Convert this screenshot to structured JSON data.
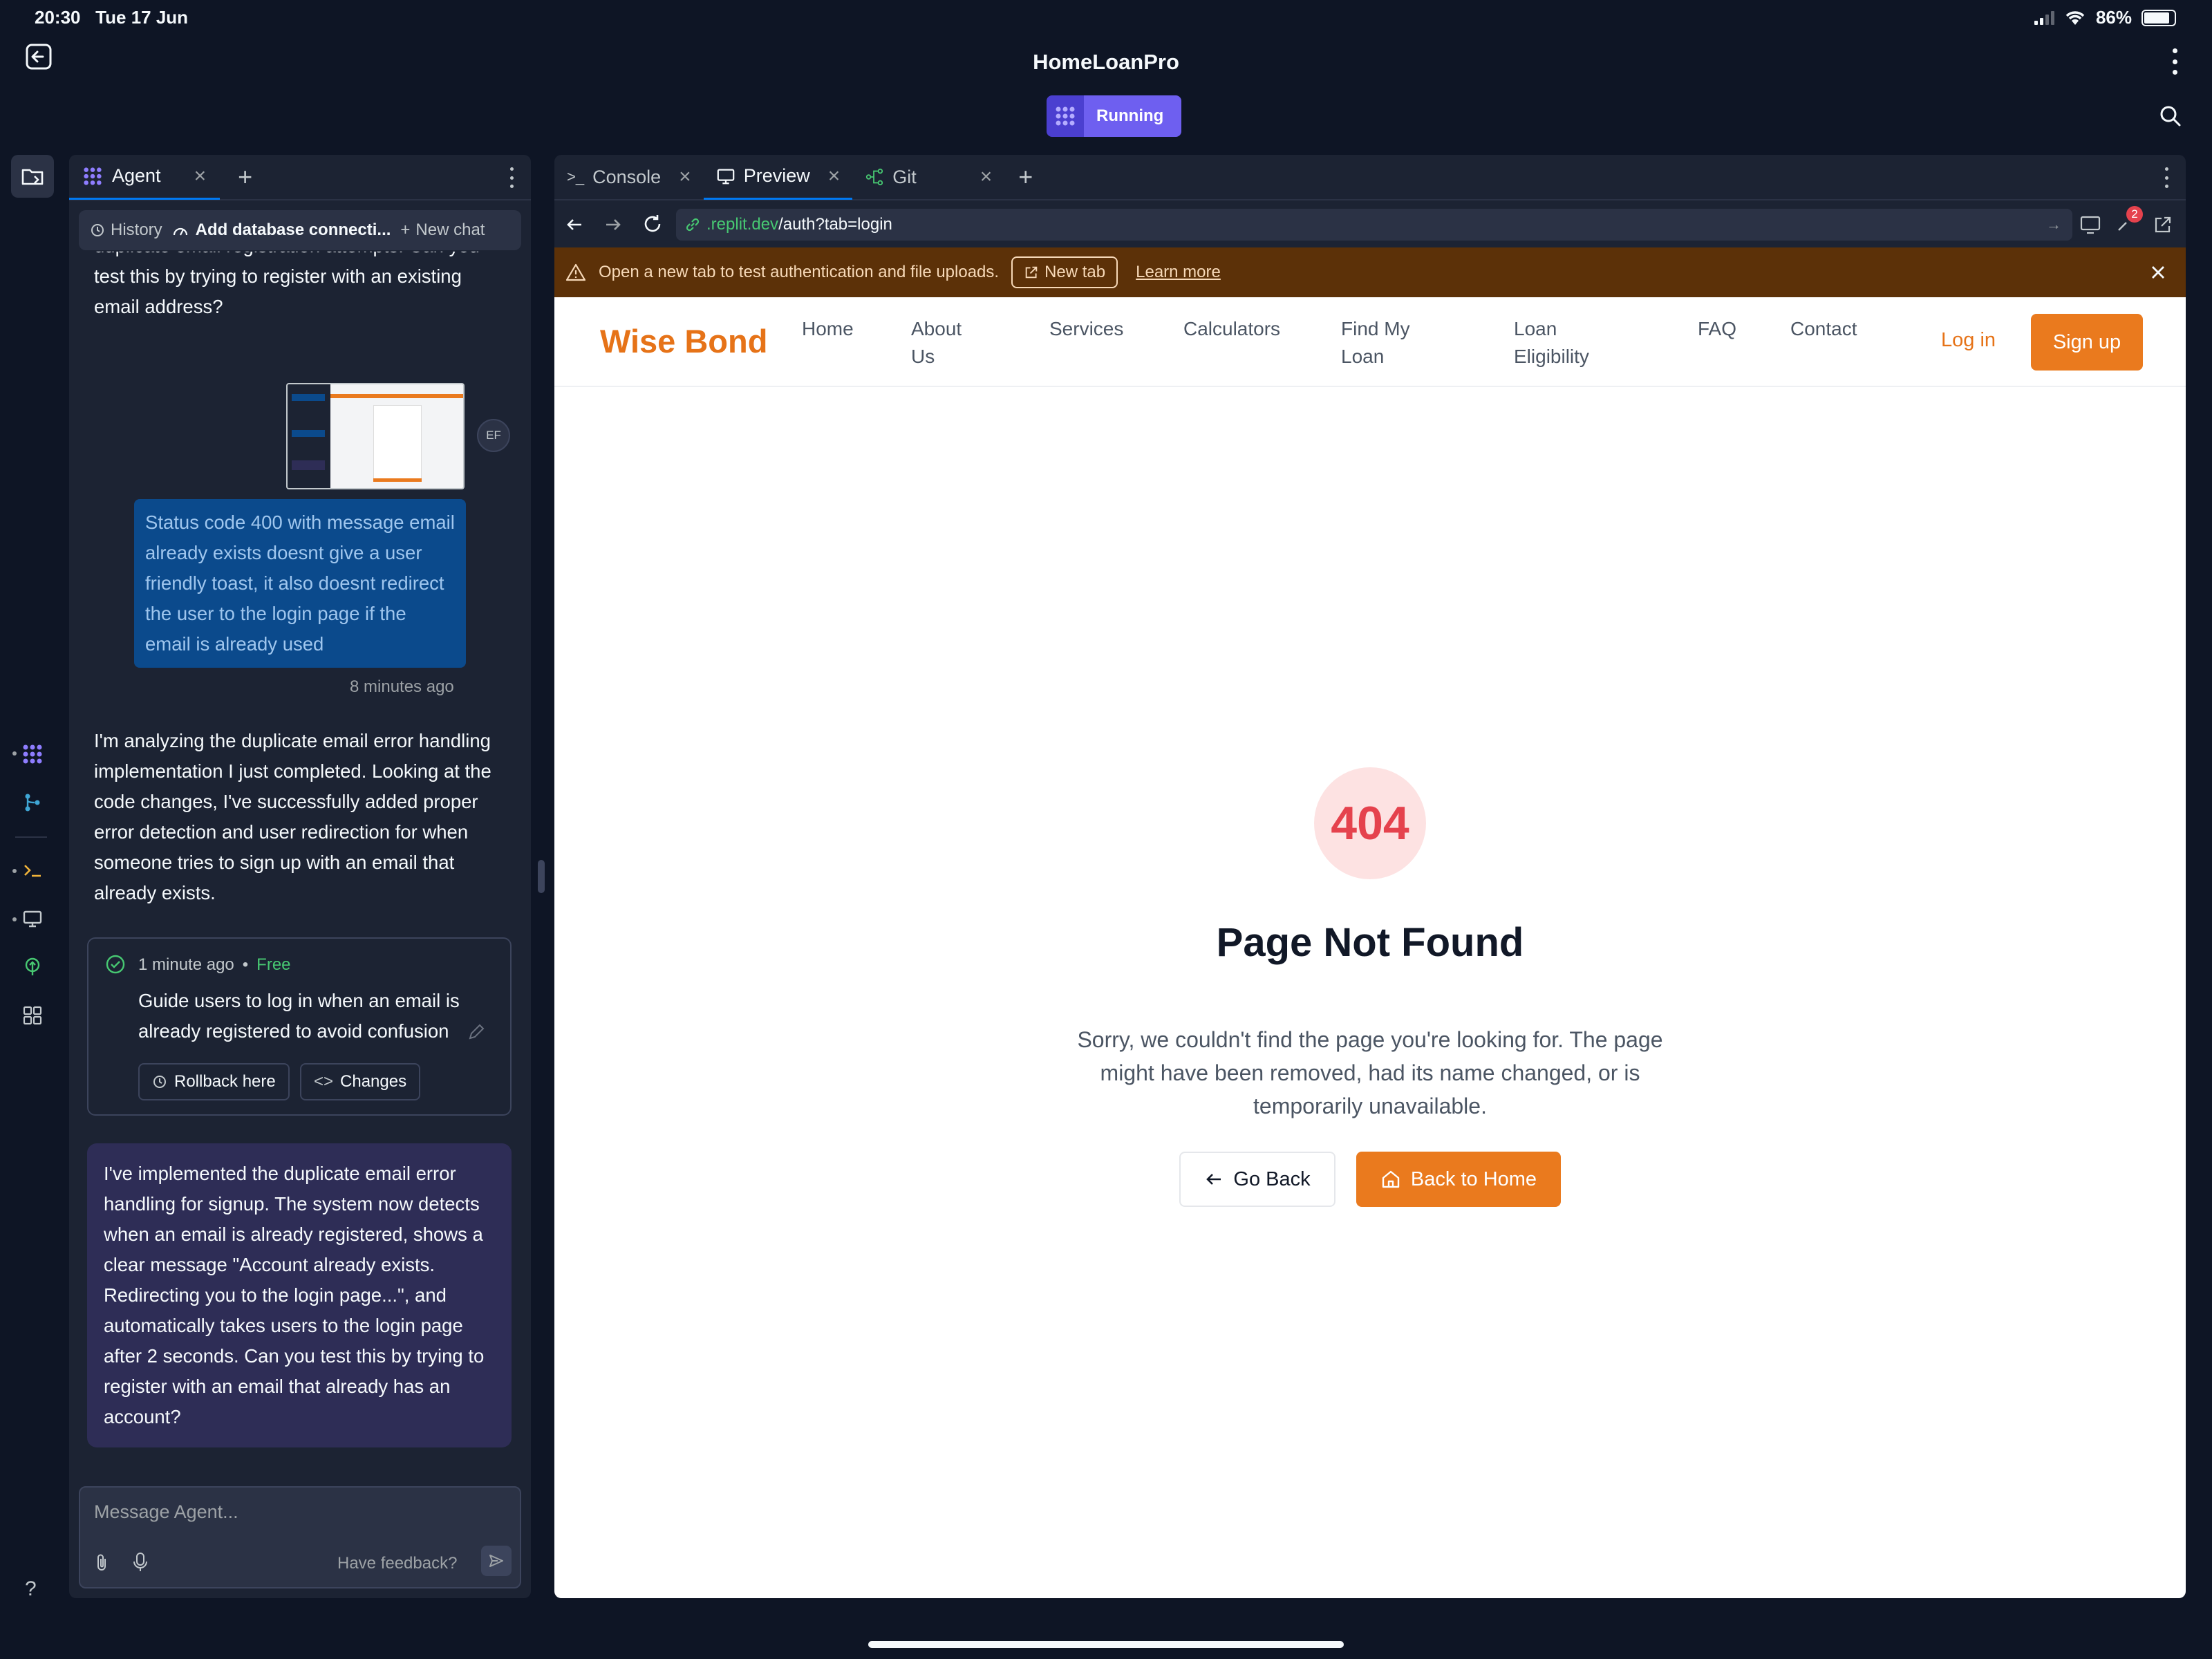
{
  "status_bar": {
    "time": "20:30",
    "date": "Tue 17 Jun",
    "battery": "86%",
    "battery_fraction": 0.86
  },
  "header": {
    "title": "HomeLoanPro",
    "run_status": "Running"
  },
  "agent_panel": {
    "tab_label": "Agent",
    "history_label": "History",
    "current_chat": "Add database connecti...",
    "new_chat_label": "New chat",
    "earlier_message": "duplicate email registration attempts. Can you test this by trying to register with an existing email address?",
    "user_avatar_initials": "EF",
    "user_message": "Status code 400 with message email already exists doesnt give a user friendly toast, it also doesnt redirect the user to the login page if the email is already used",
    "user_message_time": "8 minutes ago",
    "agent_message": "I'm analyzing the duplicate email error handling implementation I just completed. Looking at the code changes, I've successfully added proper error detection and user redirection for when someone tries to sign up with an email that already exists.",
    "checkpoint": {
      "time": "1 minute ago",
      "separator": "•",
      "price": "Free",
      "description": "Guide users to log in when an email is already registered to avoid confusion",
      "rollback_label": "Rollback here",
      "changes_label": "Changes"
    },
    "final_message": "I've implemented the duplicate email error handling for signup. The system now detects when an email is already registered, shows a clear message \"Account already exists. Redirecting you to the login page...\", and automatically takes users to the login page after 2 seconds. Can you test this by trying to register with an email that already has an account?",
    "input_placeholder": "Message Agent...",
    "feedback_label": "Have feedback?"
  },
  "workspace": {
    "tabs": [
      {
        "label": "Console",
        "prefix": ">_"
      },
      {
        "label": "Preview"
      },
      {
        "label": "Git"
      }
    ],
    "url_host": ".replit.dev",
    "url_path": "/auth?tab=login",
    "notification_count": "2",
    "warning_text": "Open a new tab to test authentication and file uploads.",
    "warning_new_tab": "New tab",
    "warning_learn_more": "Learn more"
  },
  "site": {
    "brand": "Wise Bond",
    "nav": [
      "Home",
      "About Us",
      "Services",
      "Calculators",
      "Find My Loan",
      "Loan Eligibility",
      "FAQ",
      "Contact"
    ],
    "login_label": "Log in",
    "signup_label": "Sign up",
    "error_code": "404",
    "error_title": "Page Not Found",
    "error_body": "Sorry, we couldn't find the page you're looking for. The page might have been removed, had its name changed, or is temporarily unavailable.",
    "go_back_label": "Go Back",
    "back_home_label": "Back to Home"
  },
  "colors": {
    "background": "#0e1525",
    "panel": "#1c2333",
    "accent_purple": "#6e5ff0",
    "brand_orange": "#ea7a1e",
    "error_red": "#e5424d",
    "warning_bg": "#5c3108"
  }
}
